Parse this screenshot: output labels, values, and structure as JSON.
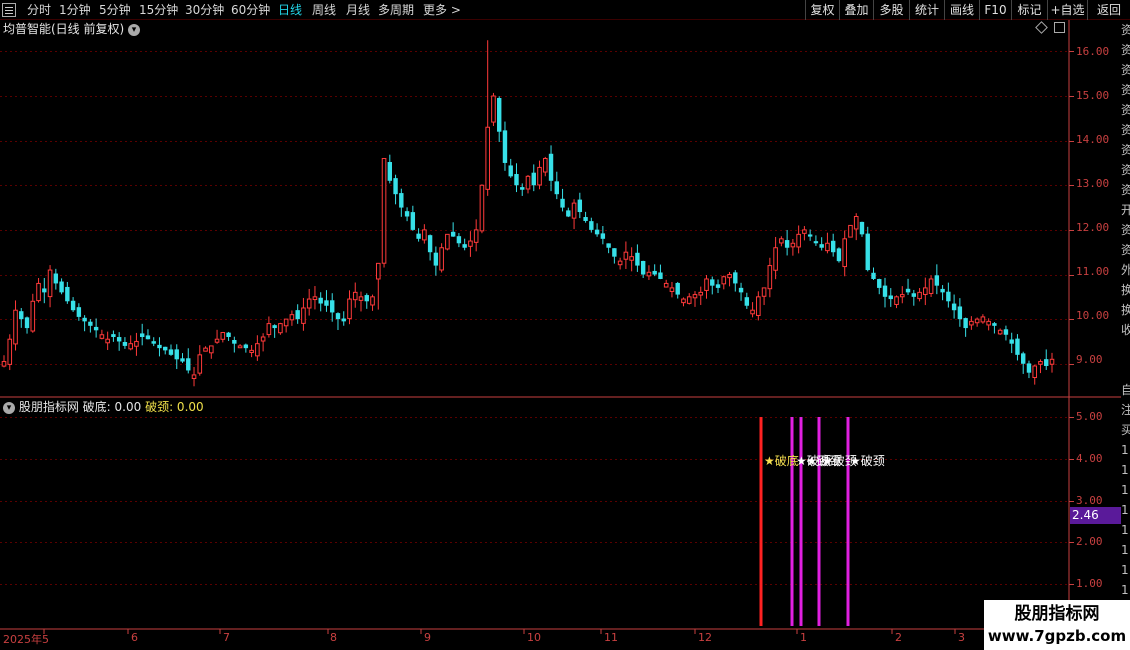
{
  "toolbar": {
    "periods": [
      "分时",
      "1分钟",
      "5分钟",
      "15分钟",
      "30分钟",
      "60分钟",
      "日线",
      "周线",
      "月线",
      "多周期",
      "更多 >"
    ],
    "active_period": "日线",
    "right_buttons": [
      "复权",
      "叠加",
      "多股",
      "统计",
      "画线",
      "F10",
      "标记",
      "+自选",
      "返回"
    ]
  },
  "price_panel": {
    "title": "均普智能(日线 前复权)",
    "y_ticks": [
      "16.00",
      "15.00",
      "14.00",
      "13.00",
      "12.00",
      "11.00",
      "10.00",
      "9.00"
    ],
    "y_min": 8.3,
    "y_max": 16.3
  },
  "indicator_panel": {
    "name": "股朋指标网",
    "label1": "破底: 0.00",
    "label2": "破颈: 0.00",
    "y_ticks": [
      "5.00",
      "4.00",
      "3.00",
      "2.00",
      "1.00"
    ],
    "current_value": "2.46",
    "signal_texts": [
      "★破底",
      "★破颈",
      "★破颈",
      "★破颈",
      "★破颈"
    ]
  },
  "x_axis": {
    "labels": [
      "2025年5",
      "6",
      "7",
      "8",
      "9",
      "10",
      "11",
      "12",
      "1",
      "2",
      "3"
    ]
  },
  "side_strip": [
    "资",
    "资",
    "资",
    "资",
    "资",
    "资",
    "资",
    "资",
    "资",
    "开",
    "资",
    "资",
    "外",
    "换",
    "换",
    "收",
    "",
    "",
    "自",
    "注",
    "买",
    "1",
    "1",
    "1",
    "1",
    "1",
    "1",
    "1",
    "1"
  ],
  "watermark": {
    "line1": "股朋指标网",
    "line2": "www.7gpzb.com"
  },
  "colors": {
    "up": "#ff3a3a",
    "down": "#37e0e8",
    "grid": "#5a0000",
    "axis": "#c84040",
    "signal_bottom": "#ff2222",
    "signal_neck": "#e020e0"
  },
  "chart_data": {
    "type": "candlestick",
    "title": "均普智能(日线 前复权)",
    "ylim": [
      8.3,
      16.3
    ],
    "series_close": [
      9.05,
      9.55,
      10.2,
      10.0,
      9.8,
      10.4,
      10.8,
      10.6,
      11.1,
      10.8,
      10.6,
      10.4,
      10.2,
      10.05,
      9.95,
      9.85,
      9.75,
      9.65,
      9.55,
      9.6,
      9.5,
      9.4,
      9.45,
      9.5,
      9.6,
      9.55,
      9.45,
      9.35,
      9.3,
      9.2,
      9.1,
      9.05,
      8.85,
      8.75,
      9.2,
      9.35,
      9.4,
      9.55,
      9.7,
      9.6,
      9.45,
      9.4,
      9.35,
      9.3,
      9.45,
      9.6,
      9.9,
      9.8,
      9.9,
      10.0,
      10.1,
      10.0,
      10.25,
      10.45,
      10.5,
      10.35,
      10.3,
      10.15,
      10.0,
      9.95,
      10.45,
      10.6,
      10.5,
      10.4,
      10.5,
      11.25,
      13.6,
      13.1,
      12.8,
      12.5,
      12.3,
      12.0,
      11.8,
      12.0,
      11.5,
      11.2,
      11.6,
      11.9,
      11.85,
      11.7,
      11.6,
      11.75,
      12.0,
      13.0,
      14.3,
      15.0,
      14.2,
      13.5,
      13.2,
      13.0,
      12.9,
      13.2,
      13.0,
      13.4,
      13.6,
      13.1,
      12.8,
      12.5,
      12.3,
      12.6,
      12.4,
      12.2,
      12.0,
      11.9,
      11.8,
      11.6,
      11.4,
      11.3,
      11.5,
      11.4,
      11.2,
      11.0,
      11.05,
      11.0,
      10.9,
      10.8,
      10.7,
      10.55,
      10.45,
      10.5,
      10.55,
      10.6,
      10.9,
      10.75,
      10.7,
      10.95,
      11.0,
      10.8,
      10.6,
      10.3,
      10.2,
      10.5,
      10.7,
      11.2,
      11.6,
      11.8,
      11.6,
      11.7,
      11.9,
      12.0,
      11.85,
      11.7,
      11.6,
      11.7,
      11.5,
      11.3,
      11.8,
      12.1,
      12.3,
      11.9,
      11.1,
      10.9,
      10.7,
      10.5,
      10.45,
      10.5,
      10.55,
      10.6,
      10.5,
      10.6,
      10.7,
      10.9,
      10.75,
      10.6,
      10.4,
      10.2,
      10.0,
      9.8,
      9.95,
      10.0,
      10.05,
      9.95,
      9.85,
      9.75,
      9.65,
      9.45,
      9.2,
      9.0,
      8.8,
      8.95,
      9.05,
      8.95,
      9.1
    ]
  }
}
